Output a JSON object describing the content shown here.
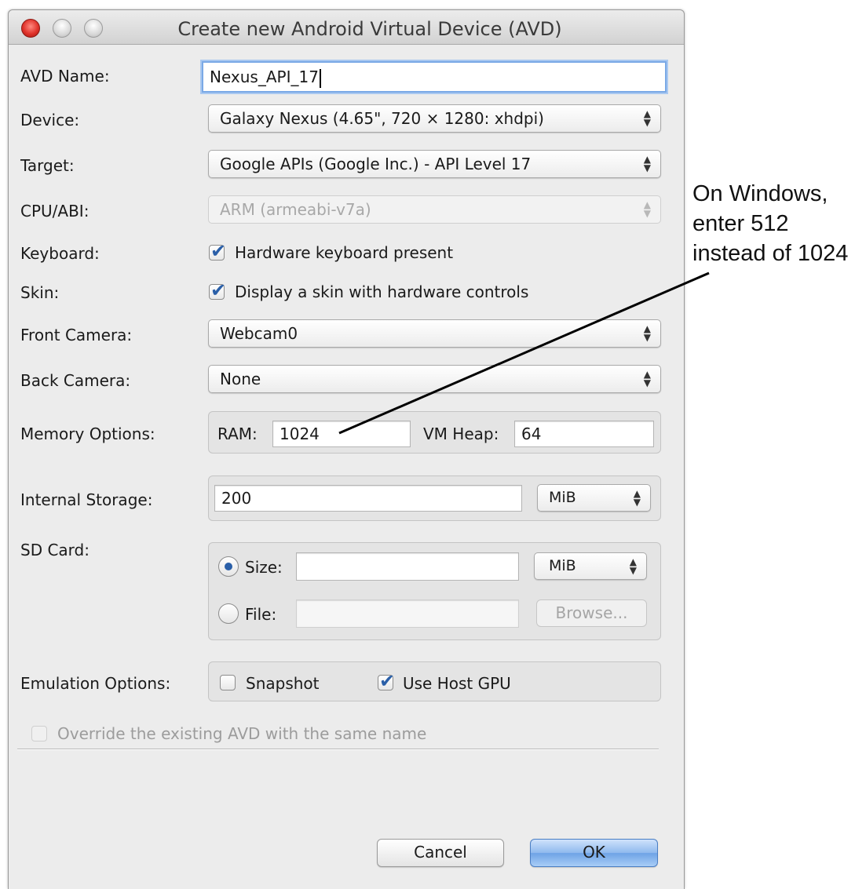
{
  "window": {
    "title": "Create new Android Virtual Device (AVD)"
  },
  "form": {
    "avd_name": {
      "label": "AVD Name:",
      "value": "Nexus_API_17"
    },
    "device": {
      "label": "Device:",
      "value": "Galaxy Nexus (4.65\", 720 × 1280: xhdpi)"
    },
    "target": {
      "label": "Target:",
      "value": "Google APIs (Google Inc.) - API Level 17"
    },
    "cpu_abi": {
      "label": "CPU/ABI:",
      "value": "ARM (armeabi-v7a)",
      "disabled": true
    },
    "keyboard": {
      "label": "Keyboard:",
      "checkbox_label": "Hardware keyboard present",
      "checked": true
    },
    "skin": {
      "label": "Skin:",
      "checkbox_label": "Display a skin with hardware controls",
      "checked": true
    },
    "front_camera": {
      "label": "Front Camera:",
      "value": "Webcam0"
    },
    "back_camera": {
      "label": "Back Camera:",
      "value": "None"
    },
    "memory": {
      "label": "Memory Options:",
      "ram_label": "RAM:",
      "ram_value": "1024",
      "vm_heap_label": "VM Heap:",
      "vm_heap_value": "64"
    },
    "internal_storage": {
      "label": "Internal Storage:",
      "value": "200",
      "unit": "MiB"
    },
    "sd_card": {
      "label": "SD Card:",
      "size_label": "Size:",
      "size_value": "",
      "size_unit": "MiB",
      "size_selected": true,
      "file_label": "File:",
      "file_value": "",
      "browse_label": "Browse..."
    },
    "emulation": {
      "label": "Emulation Options:",
      "snapshot_label": "Snapshot",
      "snapshot_checked": false,
      "host_gpu_label": "Use Host GPU",
      "host_gpu_checked": true
    },
    "override": {
      "label": "Override the existing AVD with the same name",
      "checked": false,
      "disabled": true
    }
  },
  "buttons": {
    "cancel": "Cancel",
    "ok": "OK"
  },
  "annotation": {
    "line1": "On Windows,",
    "line2": "enter 512",
    "line3": "instead of 1024"
  },
  "colors": {
    "window_bg": "#ececec",
    "focus_ring": "#7aa9e6",
    "default_button": "#6ea3e6",
    "close_light": "#e0332b"
  }
}
